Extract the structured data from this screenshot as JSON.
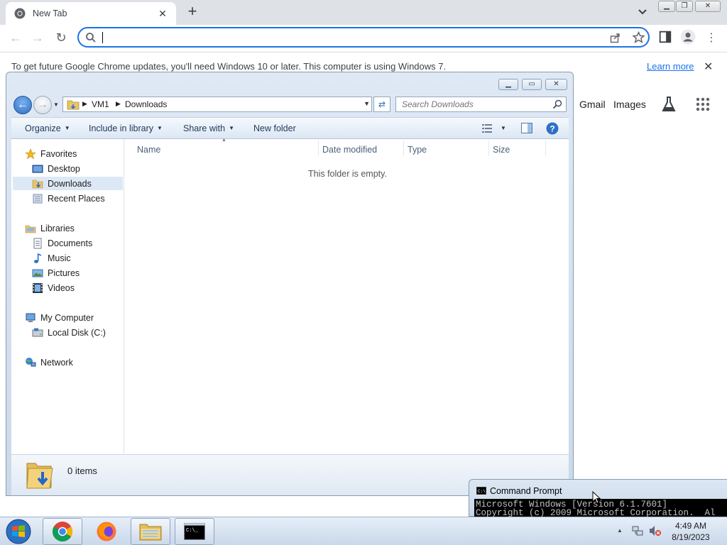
{
  "chrome": {
    "tab_title": "New Tab",
    "omnibox_value": "",
    "omnibox_placeholder": "",
    "infobar_message": "To get future Google Chrome updates, you'll need Windows 10 or later. This computer is using Windows 7.",
    "infobar_link": "Learn more",
    "ntp_links": {
      "gmail": "Gmail",
      "images": "Images"
    },
    "accent": "#1a73e8"
  },
  "explorer": {
    "breadcrumb": [
      "VM1",
      "Downloads"
    ],
    "search_placeholder": "Search Downloads",
    "commands": {
      "organize": "Organize",
      "include": "Include in library",
      "share": "Share with",
      "new_folder": "New folder"
    },
    "nav": {
      "favorites": "Favorites",
      "desktop": "Desktop",
      "downloads": "Downloads",
      "recent": "Recent Places",
      "libraries": "Libraries",
      "documents": "Documents",
      "music": "Music",
      "pictures": "Pictures",
      "videos": "Videos",
      "computer": "My Computer",
      "local_disk": "Local Disk (C:)",
      "network": "Network"
    },
    "columns": {
      "name": "Name",
      "date": "Date modified",
      "type": "Type",
      "size": "Size"
    },
    "empty_message": "This folder is empty.",
    "item_count": "0 items"
  },
  "cmd": {
    "title": "Command Prompt",
    "line1": "Microsoft Windows [Version 6.1.7601]",
    "line2": "Copyright (c) 2009 Microsoft Corporation.  Al"
  },
  "taskbar": {
    "time": "4:49 AM",
    "date": "8/19/2023"
  }
}
